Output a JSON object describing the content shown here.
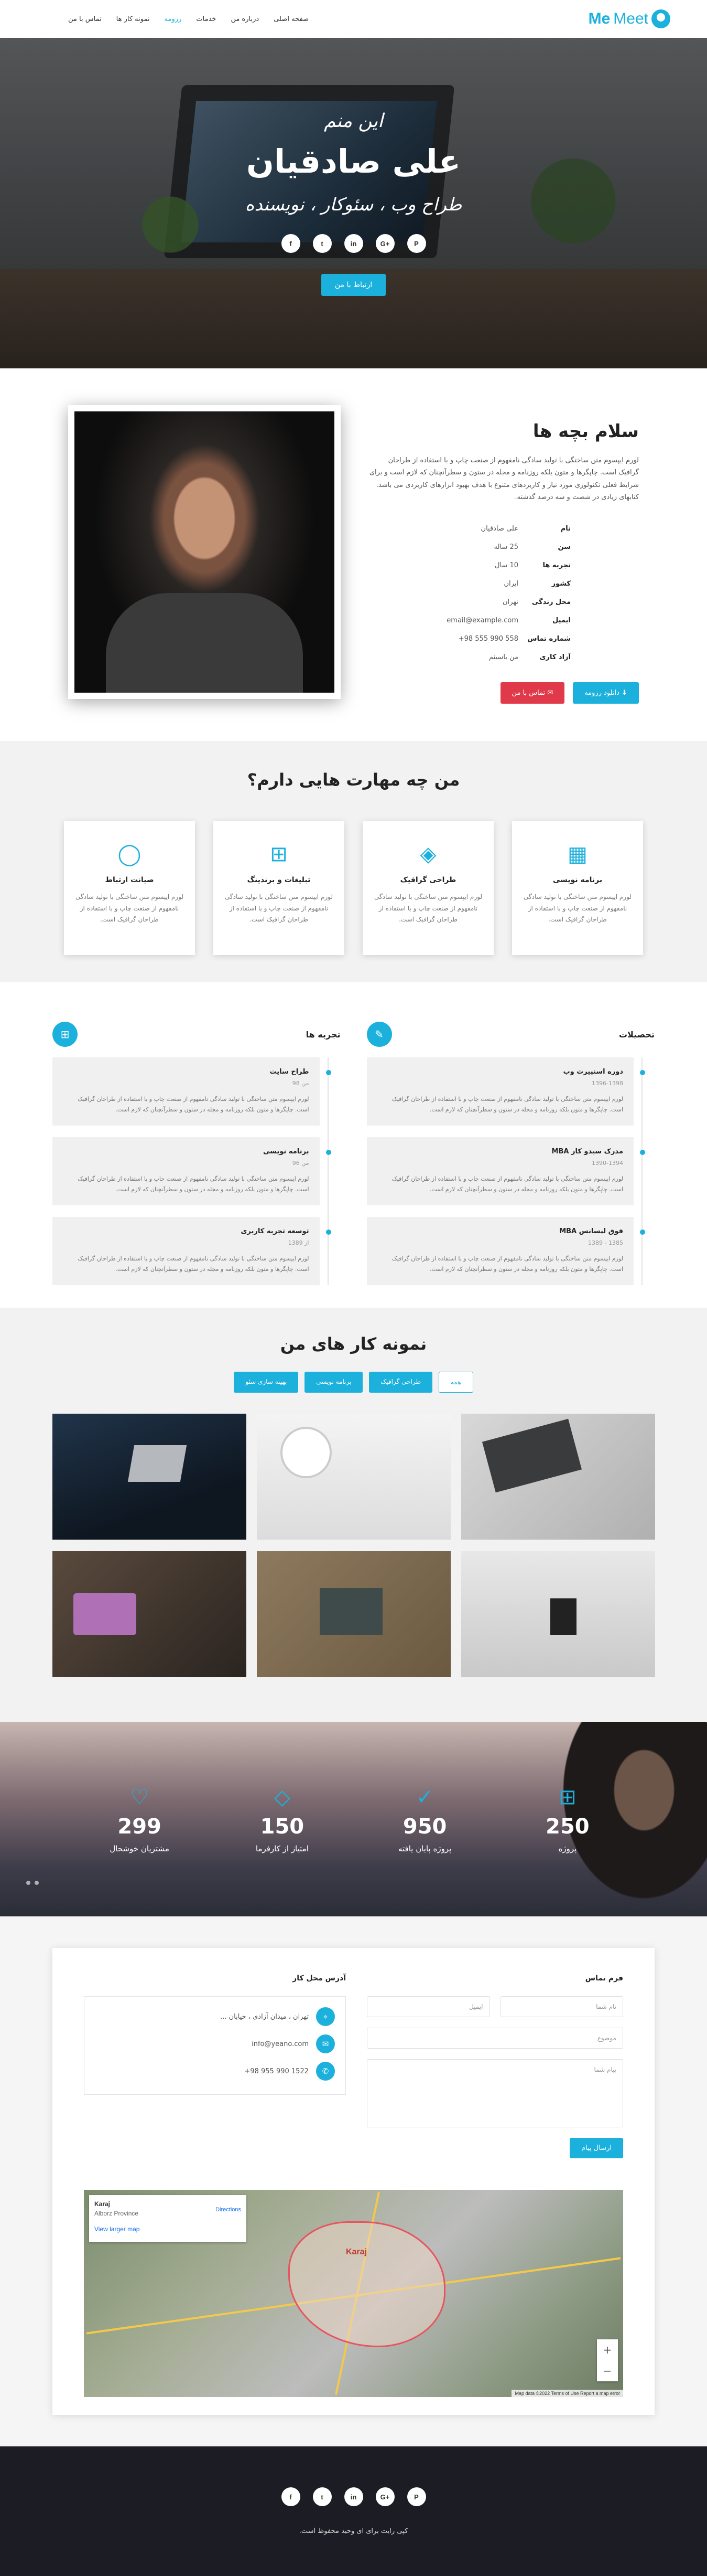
{
  "nav": {
    "logo_meet": "Meet",
    "logo_me": "Me",
    "links": [
      "صفحه اصلی",
      "درباره من",
      "خدمات",
      "رزومه",
      "نمونه کار ها",
      "تماس با من"
    ],
    "active_index": 3
  },
  "hero": {
    "intro": "این منم",
    "name": "علی صادقیان",
    "roles": "طراح وب ، سئوکار ، نویسنده",
    "social": [
      "f",
      "t",
      "in",
      "G+",
      "P"
    ],
    "cta": "ارتباط با من"
  },
  "about": {
    "title": "سلام بچه ها",
    "text": "لورم ایپسوم متن ساختگی با تولید سادگی نامفهوم از صنعت چاپ و با استفاده از طراحان گرافیک است. چاپگرها و متون بلکه روزنامه و مجله در ستون و سطرآنچنان که لازم است و برای شرایط فعلی تکنولوژی مورد نیاز و کاربردهای متنوع با هدف بهبود ابزارهای کاربردی می باشد. کتابهای زیادی در شصت و سه درصد گذشته.",
    "info": [
      {
        "key": "نام",
        "value": "علی صادقیان"
      },
      {
        "key": "سن",
        "value": "25 ساله"
      },
      {
        "key": "تجربه ها",
        "value": "10 سال"
      },
      {
        "key": "کشور",
        "value": "ایران"
      },
      {
        "key": "محل زندگی",
        "value": "تهران"
      },
      {
        "key": "ایمیل",
        "value": "email@example.com"
      },
      {
        "key": "شماره تماس",
        "value": "+98 555 990 558"
      },
      {
        "key": "آزاد کاری",
        "value": "من یاسینم"
      }
    ],
    "download_btn": "دانلود رزومه",
    "contact_btn": "تماس با من"
  },
  "services": {
    "title": "من چه مهارت هایی دارم؟",
    "items": [
      {
        "icon": "grid-icon",
        "glyph": "▦",
        "title": "برنامه نویسی",
        "text": "لورم ایپسوم متن ساختگی با تولید سادگی نامفهوم از صنعت چاپ و با استفاده از طراحان گرافیک است."
      },
      {
        "icon": "layers-icon",
        "glyph": "◈",
        "title": "طراحی گرافیک",
        "text": "لورم ایپسوم متن ساختگی با تولید سادگی نامفهوم از صنعت چاپ و با استفاده از طراحان گرافیک است."
      },
      {
        "icon": "briefcase-icon",
        "glyph": "⊞",
        "title": "تبلیغات و برندینگ",
        "text": "لورم ایپسوم متن ساختگی با تولید سادگی نامفهوم از صنعت چاپ و با استفاده از طراحان گرافیک است."
      },
      {
        "icon": "chat-icon",
        "glyph": "◯",
        "title": "صیانت ارتباط",
        "text": "لورم ایپسوم متن ساختگی با تولید سادگی نامفهوم از صنعت چاپ و با استفاده از طراحان گرافیک است."
      }
    ]
  },
  "resume": {
    "education_title": "تحصیلات",
    "experience_title": "تجربه ها",
    "education": [
      {
        "title": "دوره اسنپیرت وب",
        "when": "1396-1398",
        "text": "لورم ایپسوم متن ساختگی با تولید سادگی نامفهوم از صنعت چاپ و با استفاده از طراحان گرافیک است. چاپگرها و متون بلکه روزنامه و مجله در ستون و سطرآنچنان که لازم است."
      },
      {
        "title": "مدرک سیدو کار MBA",
        "when": "1390-1394",
        "text": "لورم ایپسوم متن ساختگی با تولید سادگی نامفهوم از صنعت چاپ و با استفاده از طراحان گرافیک است. چاپگرها و متون بلکه روزنامه و مجله در ستون و سطرآنچنان که لازم است."
      },
      {
        "title": "فوق لیسانس MBA",
        "when": "1385 - 1389",
        "text": "لورم ایپسوم متن ساختگی با تولید سادگی نامفهوم از صنعت چاپ و با استفاده از طراحان گرافیک است. چاپگرها و متون بلکه روزنامه و مجله در ستون و سطرآنچنان که لازم است."
      }
    ],
    "experience": [
      {
        "title": "طراح سایت",
        "when": "من 98",
        "text": "لورم ایپسوم متن ساختگی با تولید سادگی نامفهوم از صنعت چاپ و با استفاده از طراحان گرافیک است. چاپگرها و متون بلکه روزنامه و مجله در ستون و سطرآنچنان که لازم است."
      },
      {
        "title": "برنامه نویسی",
        "when": "من 96",
        "text": "لورم ایپسوم متن ساختگی با تولید سادگی نامفهوم از صنعت چاپ و با استفاده از طراحان گرافیک است. چاپگرها و متون بلکه روزنامه و مجله در ستون و سطرآنچنان که لازم است."
      },
      {
        "title": "توسعه تجربه کاربری",
        "when": "از 1389",
        "text": "لورم ایپسوم متن ساختگی با تولید سادگی نامفهوم از صنعت چاپ و با استفاده از طراحان گرافیک است. چاپگرها و متون بلکه روزنامه و مجله در ستون و سطرآنچنان که لازم است."
      }
    ]
  },
  "portfolio": {
    "title": "نمونه کار های من",
    "filters": [
      "همه",
      "طراحی گرافیک",
      "برنامه نویسی",
      "بهینه سازی سئو"
    ],
    "tiles": [
      "laptop-dark",
      "clock-desk",
      "typing-hands",
      "laptop-woman",
      "typewriter-desk",
      "coffee-window"
    ]
  },
  "stats": [
    {
      "icon": "briefcase-icon",
      "glyph": "⊞",
      "num": "250",
      "label": "پروژه"
    },
    {
      "icon": "check-icon",
      "glyph": "✓",
      "num": "950",
      "label": "پروژه پایان یافته"
    },
    {
      "icon": "diamond-icon",
      "glyph": "◇",
      "num": "150",
      "label": "امتیاز از کارفرما"
    },
    {
      "icon": "heart-icon",
      "glyph": "♡",
      "num": "299",
      "label": "مشتریان خوشحال"
    }
  ],
  "contact": {
    "form_title": "فرم تماس",
    "name_ph": "نام شما",
    "email_ph": "ایمیل",
    "subject_ph": "موضوع",
    "message_ph": "پیام شما",
    "send": "ارسال پیام",
    "address_title": "آدرس محل کار",
    "address": "تهران ، میدان آزادی ، خیابان ...",
    "email": "info@yeano.com",
    "phone": "+98 955 990 1522"
  },
  "map": {
    "place": "Karaj",
    "region": "Alborz Province",
    "directions": "Directions",
    "larger": "View larger map",
    "city_label": "Karaj",
    "attrib": "Map data ©2022  Terms of Use  Report a map error"
  },
  "footer": {
    "social": [
      "f",
      "t",
      "in",
      "G+",
      "P"
    ],
    "copy": "کپی رایت برای ای وحید محفوظ است."
  }
}
